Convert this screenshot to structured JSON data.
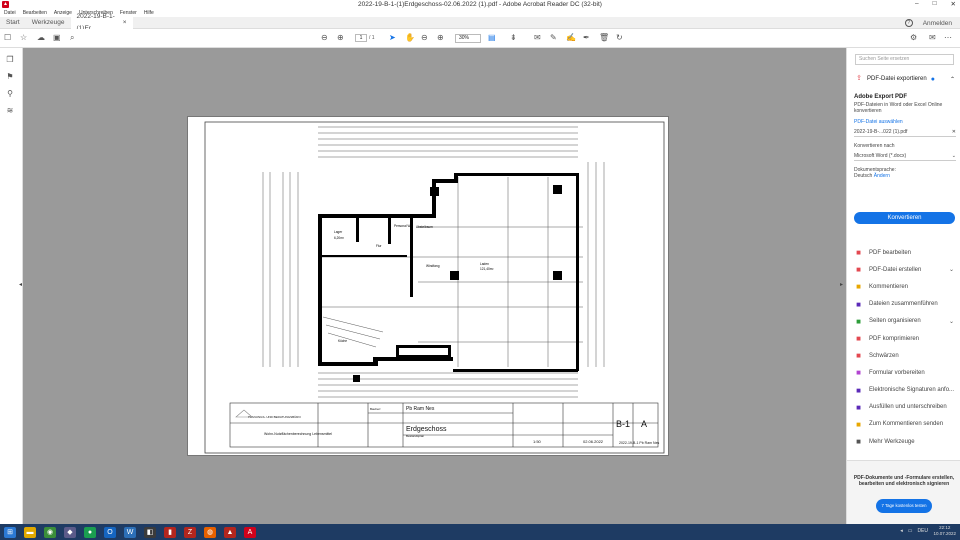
{
  "titlebar": {
    "title": "2022-19-B-1-(1)Erdgeschoss-02.06.2022 (1).pdf - Adobe Acrobat Reader DC (32-bit)",
    "app_icon": "acrobat-icon",
    "minimize": "–",
    "maximize": "□",
    "close": "✕"
  },
  "menu": [
    "Datei",
    "Bearbeiten",
    "Anzeige",
    "Unterschreiben",
    "Fenster",
    "Hilfe"
  ],
  "tabs": {
    "home": "Start",
    "tools": "Werkzeuge",
    "doc": "2022-19-B-1-(1)Er...",
    "doc_close": "×"
  },
  "account": {
    "help": "?",
    "signin": "Anmelden"
  },
  "toolbar": {
    "page_current": "1",
    "page_total": "/ 1",
    "zoom": "30%"
  },
  "page_content": {
    "company": "PLANUNGS- UND BERATUNGSBÜRO",
    "project_label": "Bauherr",
    "client": "Pb Ram Nes",
    "plan_title": "Erdgeschoss",
    "plan_subtitle": "Bestandsplan",
    "plan_kind": "Wohn-Nutzflächenberechnung Lebensmittel",
    "scale_label": "1:50",
    "date": "02.06.2022",
    "plan_no": "B-1",
    "index": "A",
    "plan_footer": "2022-19-B-1 Pb Ram Nes",
    "rooms": [
      {
        "id": "1.08",
        "name": "Lager",
        "area": "6,20m²"
      },
      {
        "id": "1.06",
        "name": "Flur",
        "area": "5,90m²"
      },
      {
        "id": "1.07",
        "name": "Personal WC",
        "area": "2,60m²"
      },
      {
        "id": "1.05",
        "name": "Abstellraum",
        "area": "2,80m²"
      },
      {
        "id": "1.01",
        "name": "Laden",
        "area": "121,40m²"
      },
      {
        "id": "1.09",
        "name": "Küche",
        "area": "8,80m²"
      },
      {
        "id": "1.02",
        "name": "Windfang",
        "area": "3,80m²"
      },
      {
        "id": "1.03",
        "name": "Abstellraum",
        "area": "6,10m²"
      }
    ]
  },
  "rightpane": {
    "search_placeholder": "Suchen Seite ersetzen",
    "export_header": "PDF-Datei exportieren",
    "export_title": "Adobe Export PDF",
    "export_desc": "PDF-Dateien in Word oder Excel Online konvertieren",
    "select_label": "PDF-Datei auswählen",
    "file_name": "2022-19-B-...022 (1).pdf",
    "convert_to_label": "Konvertieren nach",
    "format": "Microsoft Word (*.docx)",
    "doc_language_label": "Dokumentsprache:",
    "doc_language": "Deutsch",
    "change_link": "Ändern",
    "convert_button": "Konvertieren",
    "tools": [
      {
        "label": "PDF bearbeiten",
        "icon": "edit-pdf-icon",
        "color": "#e34850",
        "chev": ""
      },
      {
        "label": "PDF-Datei erstellen",
        "icon": "create-pdf-icon",
        "color": "#e34850",
        "chev": "⌄"
      },
      {
        "label": "Kommentieren",
        "icon": "comment-icon",
        "color": "#e8a700",
        "chev": ""
      },
      {
        "label": "Dateien zusammenführen",
        "icon": "combine-icon",
        "color": "#5b2ab8",
        "chev": ""
      },
      {
        "label": "Seiten organisieren",
        "icon": "organize-pages-icon",
        "color": "#2d9d3a",
        "chev": "⌄"
      },
      {
        "label": "PDF komprimieren",
        "icon": "compress-icon",
        "color": "#e34850",
        "chev": ""
      },
      {
        "label": "Schwärzen",
        "icon": "redact-icon",
        "color": "#e34850",
        "chev": ""
      },
      {
        "label": "Formular vorbereiten",
        "icon": "form-icon",
        "color": "#b244d1",
        "chev": ""
      },
      {
        "label": "Elektronische Signaturen anfo...",
        "icon": "signature-request-icon",
        "color": "#5b2ab8",
        "chev": ""
      },
      {
        "label": "Ausfüllen und unterschreiben",
        "icon": "fill-sign-icon",
        "color": "#5b2ab8",
        "chev": ""
      },
      {
        "label": "Zum Kommentieren senden",
        "icon": "send-comment-icon",
        "color": "#e8a700",
        "chev": ""
      },
      {
        "label": "Mehr Werkzeuge",
        "icon": "more-tools-icon",
        "color": "#555555",
        "chev": ""
      }
    ],
    "promo_text": "PDF-Dokumente und -Formulare erstellen, bearbeiten und elektronisch signieren",
    "promo_button": "7 Tage kostenlos testen"
  },
  "taskbar": {
    "time": "22:12",
    "date": "10.07.2022",
    "lang": "DEU"
  }
}
